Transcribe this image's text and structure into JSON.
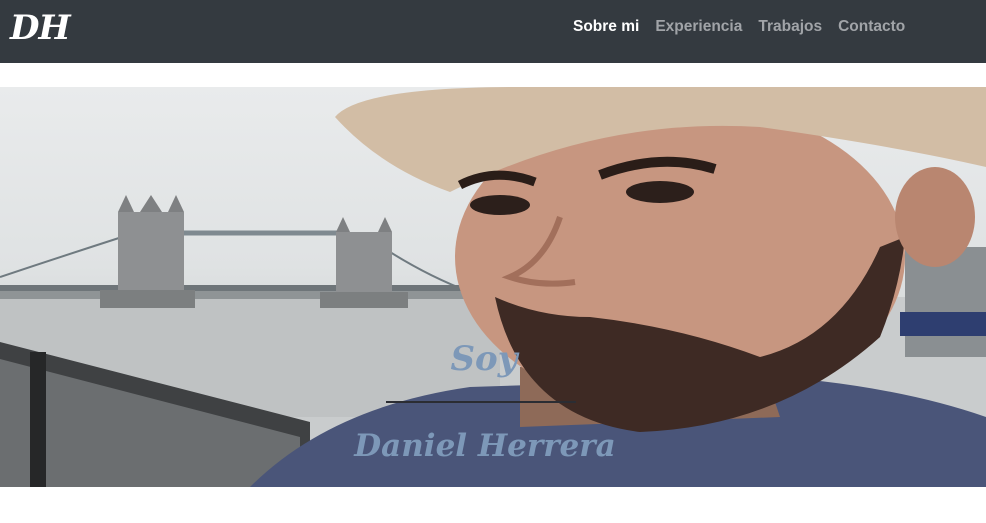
{
  "navbar": {
    "brand": "DH",
    "items": [
      {
        "label": "Sobre mi",
        "active": true
      },
      {
        "label": "Experiencia",
        "active": false
      },
      {
        "label": "Trabajos",
        "active": false
      },
      {
        "label": "Contacto",
        "active": false
      }
    ]
  },
  "hero": {
    "greeting": "Soy",
    "name": "Daniel Herrera"
  },
  "colors": {
    "navbar_bg": "#343a40",
    "nav_active": "#ffffff",
    "nav_inactive": "#a1a4a8",
    "hero_text": "#7d98b8"
  }
}
